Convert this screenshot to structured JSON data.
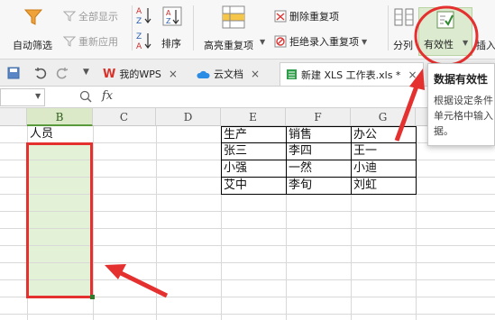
{
  "ribbon": {
    "autofilter": "自动筛选",
    "show_all": "全部显示",
    "reapply": "重新应用",
    "sort": "排序",
    "highlight_dup": "高亮重复项",
    "delete_dup": "删除重复项",
    "reject_dup": "拒绝录入重复项",
    "split": "分列",
    "validity": "有效性",
    "insert": "插入"
  },
  "tabs": [
    {
      "label": "我的WPS",
      "close": "×"
    },
    {
      "label": "云文档",
      "close": "×"
    },
    {
      "label": "新建 XLS 工作表.xls *",
      "close": "×"
    }
  ],
  "formula": {
    "fx": "fx",
    "value": ""
  },
  "columns": [
    "B",
    "C",
    "D",
    "E",
    "F",
    "G"
  ],
  "sheet": {
    "b1": "人员",
    "table": [
      [
        "生产",
        "销售",
        "办公"
      ],
      [
        "张三",
        "李四",
        "王一"
      ],
      [
        "小强",
        "一然",
        "小迪"
      ],
      [
        "艾中",
        "李旬",
        "刘虹"
      ]
    ]
  },
  "tooltip": {
    "title": "数据有效性",
    "body": "根据设定条件单元格中输入据。"
  },
  "colors": {
    "highlight_red": "#e53030",
    "selection_fill": "#e3f1d6",
    "selection_header": "#dbe9c9",
    "brand_red": "#d9322b"
  }
}
